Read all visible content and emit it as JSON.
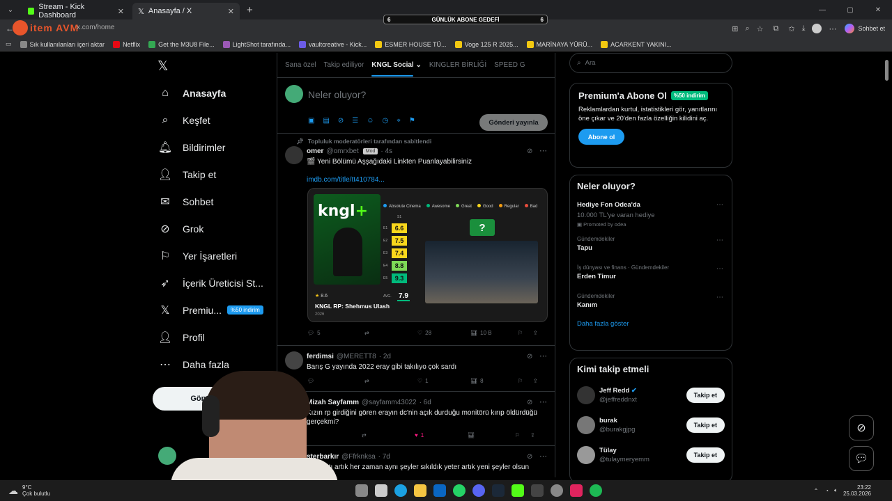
{
  "browser": {
    "tabs": [
      {
        "label": "Stream - Kick Dashboard",
        "active": false
      },
      {
        "label": "Anasayfa / X",
        "active": true
      }
    ],
    "address": "x.com/home",
    "overlay_logo": "item AVM",
    "follower_goal": {
      "left": "6",
      "label": "GÜNLÜK ABONE GEDEFİ",
      "right": "6"
    },
    "profile_label": "Sohbet et",
    "bookmarks": [
      {
        "label": "Sık kullanılanları içeri aktar",
        "color": "#888888"
      },
      {
        "label": "Netflix",
        "color": "#e50914"
      },
      {
        "label": "Get the M3U8 File...",
        "color": "#34a853"
      },
      {
        "label": "LightShot tarafında...",
        "color": "#9b59b6"
      },
      {
        "label": "vaultcreative - Kick...",
        "color": "#6c5ce7"
      },
      {
        "label": "ESMER HOUSE TÜ...",
        "color": "#f2c811"
      },
      {
        "label": "Voge 125 R 2025...",
        "color": "#f2c811"
      },
      {
        "label": "MARİNAYA YÜRÜ...",
        "color": "#f2c811"
      },
      {
        "label": "ACARKENT YAKINI...",
        "color": "#f2c811"
      }
    ]
  },
  "nav": {
    "items": [
      {
        "label": "Anasayfa",
        "icon": "home-icon",
        "glyph": "⌂",
        "bold": true
      },
      {
        "label": "Keşfet",
        "icon": "search-icon",
        "glyph": "⌕"
      },
      {
        "label": "Bildirimler",
        "icon": "bell-icon",
        "glyph": "🔔︎"
      },
      {
        "label": "Takip et",
        "icon": "follow-icon",
        "glyph": "👤︎"
      },
      {
        "label": "Sohbet",
        "icon": "mail-icon",
        "glyph": "✉"
      },
      {
        "label": "Grok",
        "icon": "grok-icon",
        "glyph": "⊘"
      },
      {
        "label": "Yer İşaretleri",
        "icon": "bookmark-icon",
        "glyph": "⚐"
      },
      {
        "label": "İçerik Üreticisi St...",
        "icon": "rocket-icon",
        "glyph": "➶"
      },
      {
        "label": "Premiu...",
        "icon": "x-logo-icon",
        "glyph": "𝕏",
        "pill": "%50 indirim"
      },
      {
        "label": "Profil",
        "icon": "profile-icon",
        "glyph": "👤︎"
      },
      {
        "label": "Daha fazla",
        "icon": "more-icon",
        "glyph": "⋯"
      }
    ],
    "post_button": "Gönderi y"
  },
  "main": {
    "tabs": [
      "Sana özel",
      "Takip ediliyor",
      "KNGL Social",
      "KINGLER BİRLİĞİ",
      "SPEED G"
    ],
    "selected_tab": 2,
    "compose_placeholder": "Neler oluyor?",
    "compose_button": "Gönderi yayınla",
    "pinned_label": "Topluluk moderatörleri tarafından sabitlendi",
    "posts": [
      {
        "name": "omer",
        "handle": "@omrxbet",
        "badge": "Mod",
        "time": "4s",
        "text": "🎬 Yeni Bölümü Aşşağıdaki Linkten Puanlayabilirsiniz",
        "link": "imdb.com/title/tt410784...",
        "replies": "5",
        "likes": "28",
        "views": "10 B"
      },
      {
        "name": "ferdimsi",
        "handle": "@MERETT8",
        "time": "2d",
        "text": "Barış G yayında 2022 eray gibi takılıyo çok sardı",
        "likes": "1",
        "views": "8"
      },
      {
        "name": "Mizah Sayfamm",
        "handle": "@sayfamm43022",
        "time": "6d",
        "text": "Kızın rp girdiğini gören erayın dc'nin açık durduğu monitörü kırıp öldürdüğü gerçekmi?",
        "likes": "1"
      },
      {
        "name": "sterbarkır",
        "handle": "@Ffrknksa",
        "time": "7d",
        "text": "sen sıktı artık her zaman aynı şeyler sıkıldık yeter artık yeni şeyler olsun"
      }
    ],
    "card": {
      "legend": [
        "Absolute Cinema",
        "Awesome",
        "Great",
        "Good",
        "Regular",
        "Bad"
      ],
      "legend_colors": [
        "#1d9bf0",
        "#00ba7c",
        "#7ed957",
        "#f9d71c",
        "#f39c12",
        "#e74c3c"
      ],
      "season": "S1",
      "episodes": [
        "E1",
        "E2",
        "E3",
        "E4",
        "E5"
      ],
      "scores": [
        "6.6",
        "7.5",
        "7.4",
        "8.8",
        "9.3"
      ],
      "score_colors": [
        "#f9d71c",
        "#f9d71c",
        "#f9d71c",
        "#7ed957",
        "#00ba7c"
      ],
      "rating": "8.6",
      "avg_label": "AVG.",
      "avg": "7.9",
      "title": "KNGL RP: Shehmus Ulash",
      "year": "2026",
      "mystery": "?"
    }
  },
  "right": {
    "search_placeholder": "Ara",
    "premium": {
      "title": "Premium'a Abone Ol",
      "badge": "%50 indirim",
      "text": "Reklamlardan kurtul, istatistikleri gör, yanıtlarını öne çıkar ve 20'den fazla özelliğin kilidini aç.",
      "button": "Abone ol"
    },
    "trends_title": "Neler oluyor?",
    "promo": {
      "title": "Hediye Fon Odea'da",
      "sub": "10.000 TL'ye varan hediye",
      "promoted": "Promoted by odea"
    },
    "trends": [
      {
        "cat": "Gündemdekiler",
        "name": "Tapu"
      },
      {
        "cat": "İş dünyası ve finans · Gündemdekiler",
        "name": "Erden Timur"
      },
      {
        "cat": "Gündemdekiler",
        "name": "Kanım"
      }
    ],
    "show_more": "Daha fazla göster",
    "who_title": "Kimi takip etmeli",
    "follow": [
      {
        "name": "Jeff Redd",
        "handle": "@jeffreddnxt",
        "verified": true
      },
      {
        "name": "burak",
        "handle": "@burakgjpg"
      },
      {
        "name": "Tülay",
        "handle": "@tulaymeryemm"
      }
    ],
    "follow_label": "Takip et"
  },
  "taskbar": {
    "weather_temp": "9°C",
    "weather_desc": "Çok bulutlu",
    "time": "23:22",
    "date": "25.03.2026"
  }
}
